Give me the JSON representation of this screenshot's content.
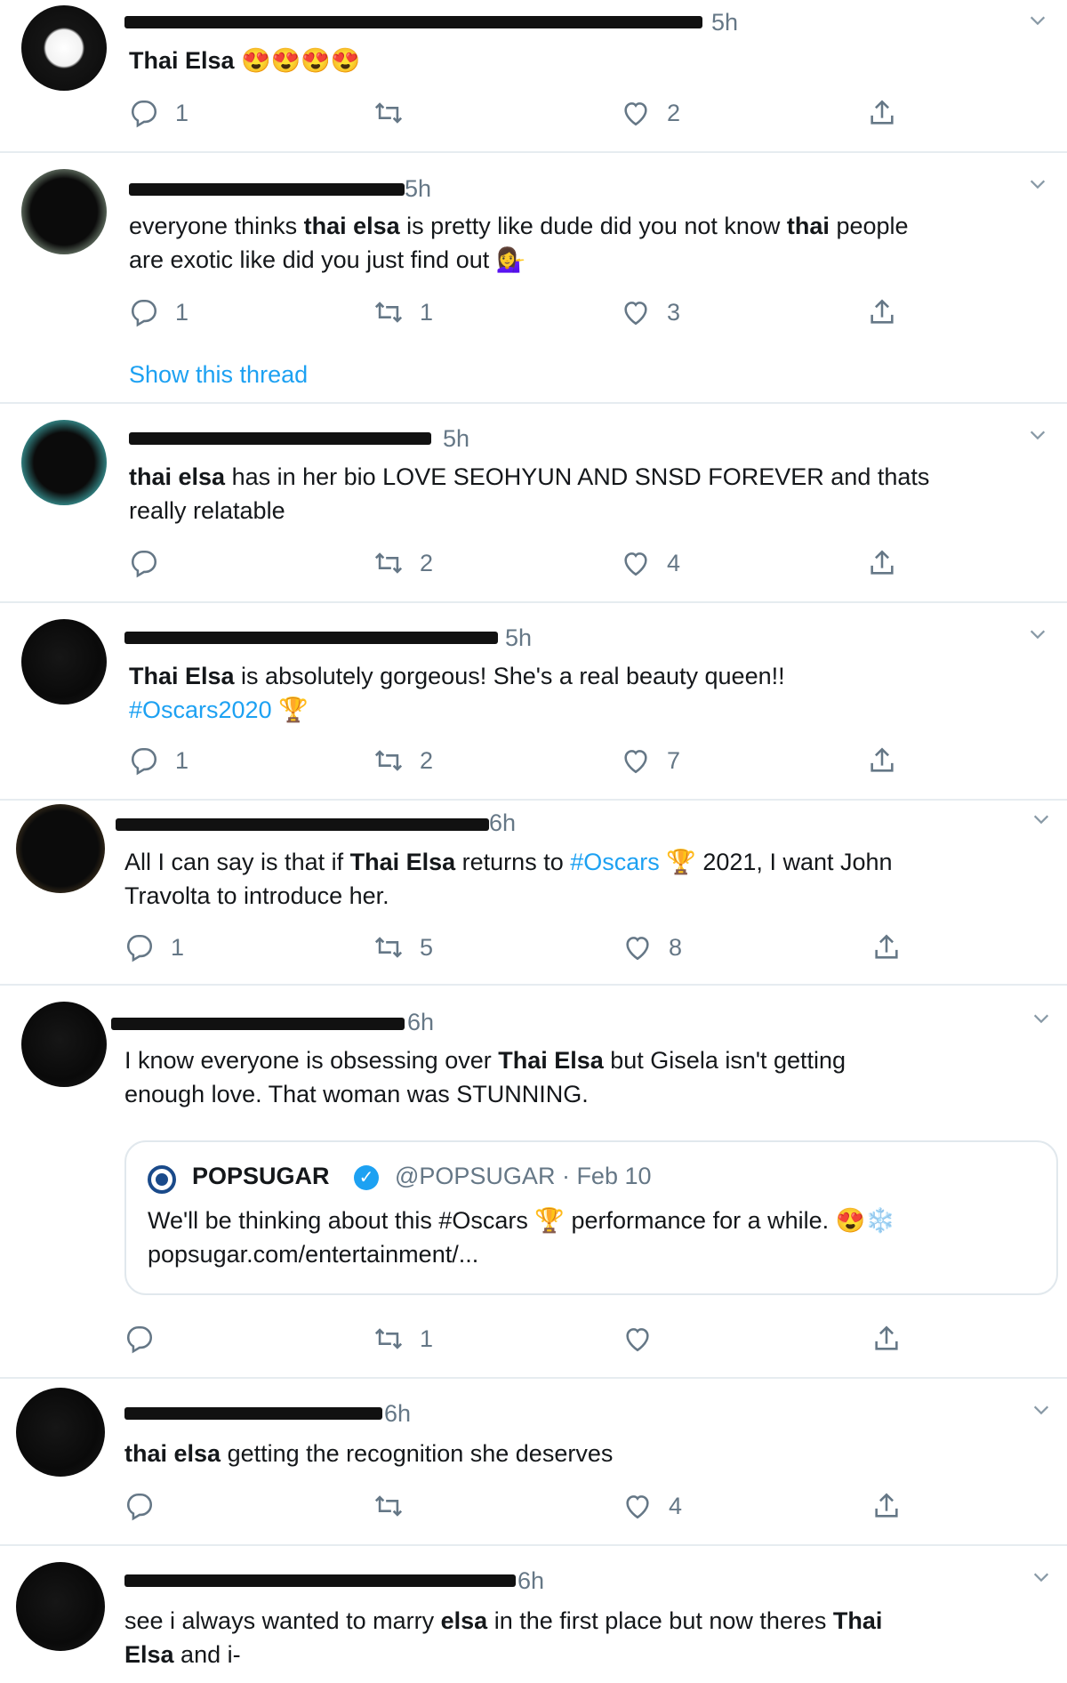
{
  "tweets": [
    {
      "time": "5h",
      "body": "Thai Elsa 😍😍😍😍",
      "replies": "1",
      "retweets": "",
      "likes": "2"
    },
    {
      "time": "5h",
      "line1_pre": "everyone thinks ",
      "line1_b1": "thai elsa",
      "line1_mid": " is pretty like dude did you not know ",
      "line1_b2": "thai",
      "line1_post": " people",
      "line2": "are exotic like did you just find out 💁‍♀️",
      "replies": "1",
      "retweets": "1",
      "likes": "3",
      "show_thread": "Show this thread"
    },
    {
      "time": "5h",
      "line1_b": "thai elsa",
      "line1_post": " has in her bio LOVE SEOHYUN AND SNSD FOREVER and thats",
      "line2": "really relatable",
      "replies": "",
      "retweets": "2",
      "likes": "4"
    },
    {
      "time": "5h",
      "line1_b": "Thai Elsa",
      "line1_post": " is absolutely gorgeous! She's a real beauty queen!!",
      "line2_tag": "#Oscars2020",
      "line2_post": " 🏆",
      "replies": "1",
      "retweets": "2",
      "likes": "7"
    },
    {
      "time": "6h",
      "line1_pre": "All I can say is that if ",
      "line1_b": "Thai Elsa",
      "line1_mid": " returns to ",
      "line1_tag": "#Oscars",
      "line1_post": " 🏆 2021, I want John",
      "line2": "Travolta to introduce her.",
      "replies": "1",
      "retweets": "5",
      "likes": "8"
    },
    {
      "time": "6h",
      "line1_pre": "I know everyone is obsessing over ",
      "line1_b": "Thai Elsa",
      "line1_post": " but Gisela isn't getting",
      "line2": "enough love. That woman was STUNNING.",
      "quote": {
        "name": "POPSUGAR",
        "handle_date": "@POPSUGAR · Feb 10",
        "text": "We'll be thinking about this #Oscars 🏆 performance for a while. 😍❄️",
        "link": "popsugar.com/entertainment/..."
      },
      "replies": "",
      "retweets": "1",
      "likes": ""
    },
    {
      "time": "6h",
      "line1_b": "thai elsa",
      "line1_post": " getting the recognition she deserves",
      "replies": "",
      "retweets": "",
      "likes": "4"
    },
    {
      "time": "6h",
      "line1_pre": "see i always wanted to marry ",
      "line1_b": "elsa",
      "line1_mid": " in the first place but now theres ",
      "line1_b2": "Thai",
      "line2_b": "Elsa",
      "line2_post": " and i-"
    }
  ]
}
